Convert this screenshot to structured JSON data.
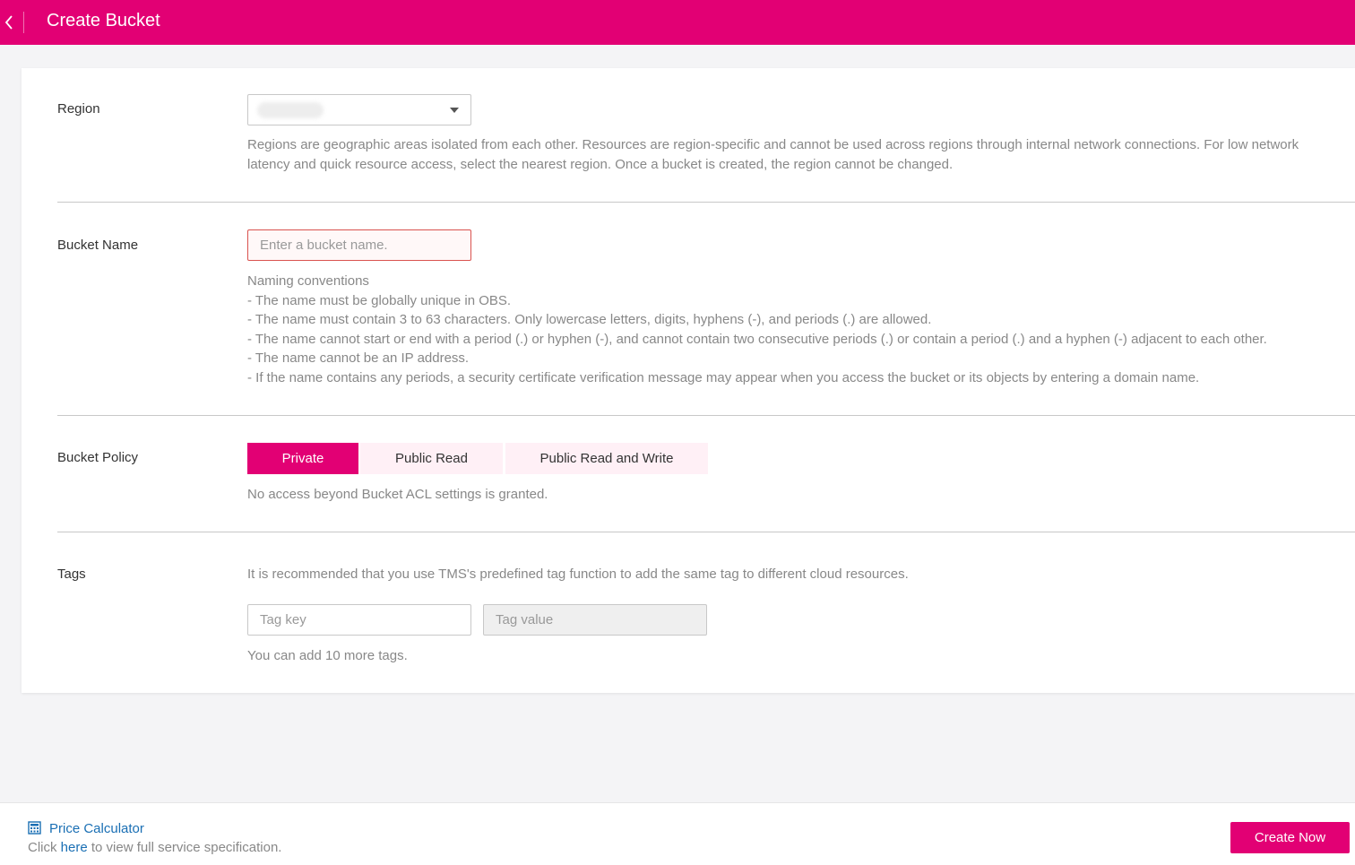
{
  "header": {
    "title": "Create Bucket",
    "back_icon": "chevron-left-icon",
    "accent_color": "#e20074"
  },
  "region": {
    "label": "Region",
    "selected_value": "",
    "description": "Regions are geographic areas isolated from each other. Resources are region-specific and cannot be used across regions through internal network connections. For low network latency and quick resource access, select the nearest region. Once a bucket is created, the region cannot be changed."
  },
  "bucket_name": {
    "label": "Bucket Name",
    "placeholder": "Enter a bucket name.",
    "value": "",
    "conventions": [
      "Naming conventions",
      "- The name must be globally unique in OBS.",
      "- The name must contain 3 to 63 characters. Only lowercase letters, digits, hyphens (-), and periods (.) are allowed.",
      "- The name cannot start or end with a period (.) or hyphen (-), and cannot contain two consecutive periods (.) or contain a period (.) and a hyphen (-) adjacent to each other.",
      "- The name cannot be an IP address.",
      "- If the name contains any periods, a security certificate verification message may appear when you access the bucket or its objects by entering a domain name."
    ]
  },
  "bucket_policy": {
    "label": "Bucket Policy",
    "options": [
      "Private",
      "Public Read",
      "Public Read and Write"
    ],
    "selected": "Private",
    "description": "No access beyond Bucket ACL settings is granted."
  },
  "tags": {
    "label": "Tags",
    "description": "It is recommended that you use TMS's predefined tag function to add the same tag to different cloud resources.",
    "key_placeholder": "Tag key",
    "value_placeholder": "Tag value",
    "remaining": "You can add 10 more tags."
  },
  "footer": {
    "calculator_label": "Price Calculator",
    "calculator_icon": "calculator-icon",
    "spec_prefix": "Click ",
    "spec_link": "here",
    "spec_suffix": " to view full service specification.",
    "create_label": "Create Now"
  }
}
